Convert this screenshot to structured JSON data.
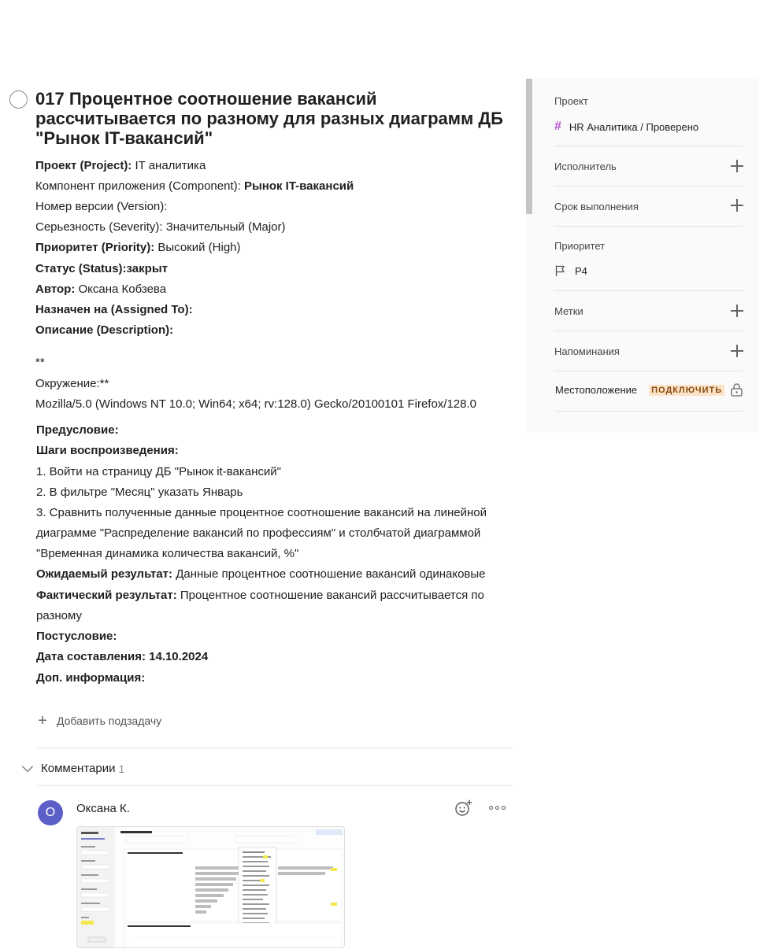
{
  "task": {
    "title": "017 Процентное соотношение вакансий рассчитывается по разному для разных диаграмм ДБ \"Рынок IT-вакансий\"",
    "fields": {
      "project_label": "Проект (Project):",
      "project_value": " IT аналитика",
      "component_label": "Компонент приложения (Component): ",
      "component_value": "Рынок IT-вакансий",
      "version_line": "Номер версии (Version):",
      "severity_line": "Серьезность (Severity): Значительный (Major)",
      "priority_label": "Приоритет (Priority):",
      "priority_value": " Высокий (High)",
      "status_line": "Статус (Status):закрыт",
      "author_label": "Автор:",
      "author_value": " Оксана Кобзева",
      "assigned_line": "Назначен на (Assigned To):",
      "description_line": "Описание (Description):"
    },
    "env": {
      "stars": "**",
      "label": "Окружение:**",
      "ua": "Mozilla/5.0 (Windows NT 10.0; Win64; x64; rv:128.0) Gecko/20100101 Firefox/128.0"
    },
    "body": {
      "precondition": "Предусловие:",
      "steps_title": "Шаги воспроизведения:",
      "step1": "1. Войти на страницу ДБ \"Рынок it-вакансий\"",
      "step2": "2. В фильтре \"Месяц\" указать Январь",
      "step3": "3. Сравнить полученные данные процентное соотношение вакансий на линейной диаграмме \"Распределение вакансий по профессиям\" и столбчатой диаграммой \"Временная динамика количества вакансий, %\"",
      "expected_label": "Ожидаемый результат:",
      "expected_value": " Данные процентное соотношение вакансий одинаковые",
      "actual_label": "Фактический результат:",
      "actual_value": " Процентное соотношение вакансий рассчитывается по разному",
      "postcondition": "Постусловие:",
      "date": "Дата составления: 14.10.2024",
      "extra": "Доп. информация:"
    },
    "add_subtask": "Добавить подзадачу"
  },
  "comments": {
    "title": "Комментарии",
    "count": "1",
    "items": [
      {
        "avatar_letter": "O",
        "author": "Оксана К.",
        "avatar_color": "#5b5fc7"
      }
    ]
  },
  "sidebar": {
    "project_label": "Проект",
    "project_value": "HR Аналитика / Проверено",
    "assignee_label": "Исполнитель",
    "due_label": "Срок выполнения",
    "priority_label": "Приоритет",
    "priority_value": "P4",
    "labels_label": "Метки",
    "reminders_label": "Напоминания",
    "location_label": "Местоположение",
    "location_badge": "ПОДКЛЮЧИТЬ"
  }
}
